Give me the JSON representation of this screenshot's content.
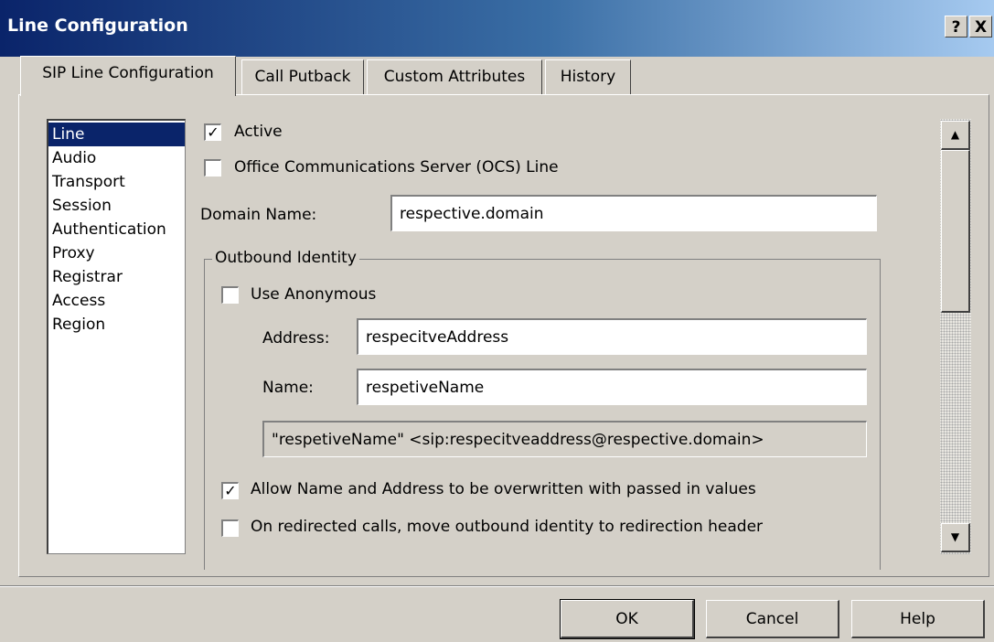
{
  "window": {
    "title": "Line Configuration",
    "help_button": "?",
    "close_button": "X"
  },
  "tabs": [
    {
      "label": "SIP Line Configuration"
    },
    {
      "label": "Call Putback"
    },
    {
      "label": "Custom Attributes"
    },
    {
      "label": "History"
    }
  ],
  "nav": {
    "items": [
      "Line",
      "Audio",
      "Transport",
      "Session",
      "Authentication",
      "Proxy",
      "Registrar",
      "Access",
      "Region"
    ],
    "selected": "Line"
  },
  "line": {
    "active_label": "Active",
    "active_checked": true,
    "ocs_label": "Office Communications Server (OCS) Line",
    "ocs_checked": false,
    "domain_label": "Domain Name:",
    "domain_value": "respective.domain"
  },
  "outbound": {
    "group_label": "Outbound Identity",
    "anonymous_label": "Use Anonymous",
    "anonymous_checked": false,
    "address_label": "Address:",
    "address_value": "respecitveAddress",
    "name_label": "Name:",
    "name_value": "respetiveName",
    "preview": "\"respetiveName\" <sip:respecitveaddress@respective.domain>",
    "allow_overwrite_label": "Allow Name and Address to be overwritten with passed in values",
    "allow_overwrite_checked": true,
    "redirect_label": "On redirected calls, move outbound identity to redirection header",
    "redirect_checked": false
  },
  "scrollbar": {
    "up_icon": "▲",
    "down_icon": "▼"
  },
  "buttons": {
    "ok": "OK",
    "cancel": "Cancel",
    "help": "Help"
  }
}
